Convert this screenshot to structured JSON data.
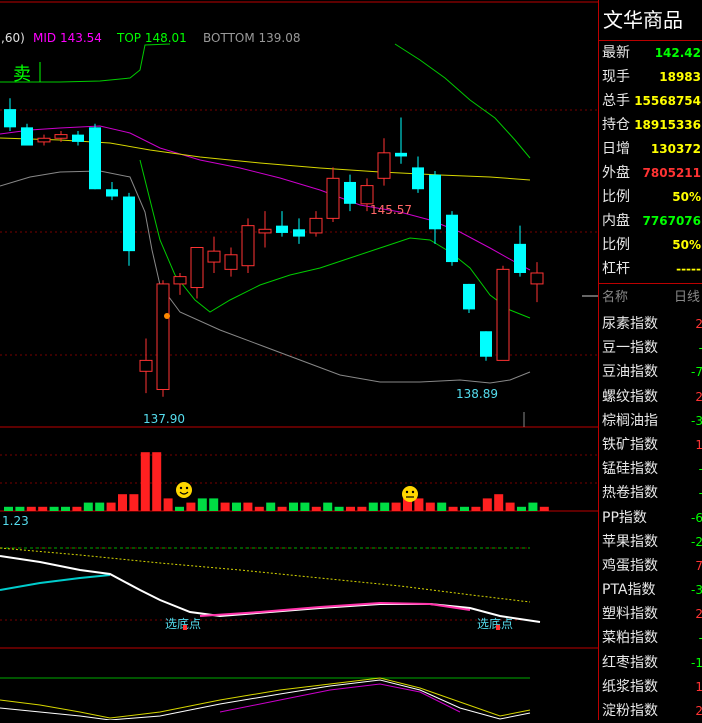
{
  "indicator_bar": {
    "params": ",60)",
    "mid": "MID 143.54",
    "top": "TOP 148.01",
    "bottom": "BOTTOM 139.08",
    "colors": {
      "mid": "#ff00ff",
      "top": "#00ff00",
      "bottom": "#888888"
    }
  },
  "main_chart": {
    "sell_signal": "卖",
    "high_label_1": "145.57",
    "low_label_1": "137.90",
    "low_label_2": "138.89"
  },
  "sub_chart": {
    "value_label": "1.23",
    "bottom_pick_1": "选底点",
    "bottom_pick_2": "选底点"
  },
  "sidebar": {
    "title": "文华商品",
    "quote": [
      {
        "label": "最新",
        "value": "142.42",
        "color": "#00ff00"
      },
      {
        "label": "现手",
        "value": "18983",
        "color": "#ffff00"
      },
      {
        "label": "总手",
        "value": "15568754",
        "color": "#ffff00"
      },
      {
        "label": "持仓",
        "value": "18915336",
        "color": "#ffff00"
      },
      {
        "label": "日增",
        "value": "130372",
        "color": "#ffff00"
      },
      {
        "label": "外盘",
        "value": "7805211",
        "color": "#ff3333"
      },
      {
        "label": "比例",
        "value": "50%",
        "color": "#ffff00"
      },
      {
        "label": "内盘",
        "value": "7767076",
        "color": "#00ff00"
      },
      {
        "label": "比例",
        "value": "50%",
        "color": "#ffff00"
      },
      {
        "label": "杠杆",
        "value": "-----",
        "color": "#ffff00"
      }
    ],
    "list_header": {
      "name": "名称",
      "right": "日线"
    },
    "list": [
      {
        "name": "尿素指数",
        "value": "2",
        "color": "#ff3333"
      },
      {
        "name": "豆一指数",
        "value": "-",
        "color": "#00ff00"
      },
      {
        "name": "豆油指数",
        "value": "-7",
        "color": "#00ff00"
      },
      {
        "name": "螺纹指数",
        "value": "2",
        "color": "#ff3333"
      },
      {
        "name": "棕榈油指",
        "value": "-3",
        "color": "#00ff00"
      },
      {
        "name": "铁矿指数",
        "value": "1",
        "color": "#ff3333"
      },
      {
        "name": "锰硅指数",
        "value": "-",
        "color": "#00ff00"
      },
      {
        "name": "热卷指数",
        "value": "-",
        "color": "#00ff00"
      },
      {
        "name": "PP指数",
        "value": "-6",
        "color": "#00ff00"
      },
      {
        "name": "苹果指数",
        "value": "-2",
        "color": "#00ff00"
      },
      {
        "name": "鸡蛋指数",
        "value": "7",
        "color": "#ff3333"
      },
      {
        "name": "PTA指数",
        "value": "-3",
        "color": "#00ff00"
      },
      {
        "name": "塑料指数",
        "value": "2",
        "color": "#ff3333"
      },
      {
        "name": "菜粕指数",
        "value": "-",
        "color": "#00ff00"
      },
      {
        "name": "红枣指数",
        "value": "-1",
        "color": "#00ff00"
      },
      {
        "name": "纸浆指数",
        "value": "1",
        "color": "#ff3333"
      },
      {
        "name": "淀粉指数",
        "value": "2",
        "color": "#ff3333"
      }
    ]
  },
  "chart_data": {
    "type": "candlestick",
    "up_color": "#ff3333",
    "down_color": "#00ffff",
    "candles": [
      {
        "o": 145.8,
        "h": 146.1,
        "l": 145.2,
        "c": 145.3
      },
      {
        "o": 145.3,
        "h": 145.4,
        "l": 144.8,
        "c": 144.8
      },
      {
        "o": 144.9,
        "h": 145.1,
        "l": 144.8,
        "c": 145.0
      },
      {
        "o": 145.0,
        "h": 145.2,
        "l": 144.9,
        "c": 145.1
      },
      {
        "o": 145.1,
        "h": 145.2,
        "l": 144.8,
        "c": 144.9
      },
      {
        "o": 145.3,
        "h": 145.4,
        "l": 143.6,
        "c": 143.6
      },
      {
        "o": 143.6,
        "h": 143.8,
        "l": 143.3,
        "c": 143.4
      },
      {
        "o": 143.4,
        "h": 143.5,
        "l": 141.5,
        "c": 141.9
      },
      {
        "o": 138.6,
        "h": 139.5,
        "l": 138.0,
        "c": 138.9
      },
      {
        "o": 138.1,
        "h": 141.1,
        "l": 137.9,
        "c": 141.0
      },
      {
        "o": 141.0,
        "h": 141.3,
        "l": 140.7,
        "c": 141.2
      },
      {
        "o": 140.9,
        "h": 142.0,
        "l": 140.6,
        "c": 142.0
      },
      {
        "o": 141.6,
        "h": 142.3,
        "l": 141.3,
        "c": 141.9
      },
      {
        "o": 141.4,
        "h": 142.0,
        "l": 141.2,
        "c": 141.8
      },
      {
        "o": 141.5,
        "h": 142.8,
        "l": 141.3,
        "c": 142.6
      },
      {
        "o": 142.4,
        "h": 143.0,
        "l": 142.0,
        "c": 142.5
      },
      {
        "o": 142.6,
        "h": 143.0,
        "l": 142.3,
        "c": 142.4
      },
      {
        "o": 142.5,
        "h": 142.8,
        "l": 142.1,
        "c": 142.3
      },
      {
        "o": 142.4,
        "h": 143.0,
        "l": 142.3,
        "c": 142.8
      },
      {
        "o": 142.8,
        "h": 144.2,
        "l": 142.7,
        "c": 143.9
      },
      {
        "o": 143.8,
        "h": 144.0,
        "l": 143.0,
        "c": 143.2
      },
      {
        "o": 143.2,
        "h": 143.9,
        "l": 143.0,
        "c": 143.7
      },
      {
        "o": 143.9,
        "h": 145.0,
        "l": 143.7,
        "c": 144.6
      },
      {
        "o": 144.6,
        "h": 145.57,
        "l": 144.3,
        "c": 144.5
      },
      {
        "o": 144.2,
        "h": 144.5,
        "l": 143.5,
        "c": 143.6
      },
      {
        "o": 144.0,
        "h": 144.1,
        "l": 142.1,
        "c": 142.5
      },
      {
        "o": 142.9,
        "h": 143.0,
        "l": 141.5,
        "c": 141.6
      },
      {
        "o": 141.0,
        "h": 141.0,
        "l": 140.2,
        "c": 140.3
      },
      {
        "o": 139.7,
        "h": 139.7,
        "l": 138.89,
        "c": 139.0
      },
      {
        "o": 138.9,
        "h": 141.5,
        "l": 138.9,
        "c": 141.4
      },
      {
        "o": 142.1,
        "h": 142.6,
        "l": 141.2,
        "c": 141.3
      },
      {
        "o": 141.0,
        "h": 141.6,
        "l": 140.5,
        "c": 141.3
      }
    ],
    "volume": [
      1,
      1,
      1,
      1,
      1,
      1,
      1,
      2,
      2,
      2,
      4,
      4,
      14,
      14,
      3,
      1,
      2,
      3,
      3,
      2,
      2,
      2,
      1,
      2,
      1,
      2,
      2,
      1,
      2,
      1,
      1,
      1,
      2,
      2,
      2,
      3,
      3,
      2,
      2,
      1,
      1,
      1,
      3,
      4,
      2,
      1,
      2,
      1
    ],
    "volume_up": [
      false,
      false,
      true,
      true,
      false,
      false,
      true,
      false,
      false,
      true,
      true,
      true,
      true,
      true,
      true,
      false,
      true,
      false,
      false,
      true,
      false,
      true,
      true,
      false,
      true,
      false,
      false,
      true,
      false,
      false,
      true,
      true,
      false,
      false,
      true,
      true,
      true,
      true,
      false,
      true,
      false,
      true,
      true,
      true,
      true,
      false,
      false,
      true
    ]
  }
}
